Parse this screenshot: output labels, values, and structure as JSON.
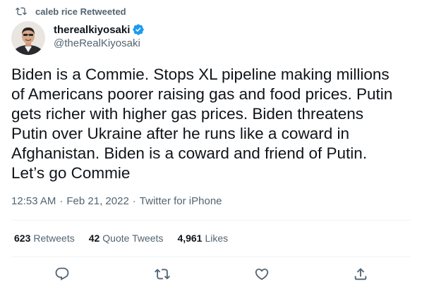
{
  "retweet_context": {
    "label": "caleb rice Retweeted",
    "icon": "retweet-icon"
  },
  "author": {
    "display_name": "therealkiyosaki",
    "handle": "@theRealKiyosaki",
    "verified": true,
    "verified_icon": "verified-badge-icon"
  },
  "tweet": {
    "text": "Biden is a Commie. Stops XL pipeline making millions\nof Americans poorer raising gas and food prices. Putin\ngets richer with higher gas prices.  Biden threatens\nPutin over Ukraine after he runs like a coward in\nAfghanistan. Biden is a coward and friend of Putin.\nLet’s go Commie",
    "time": "12:53 AM",
    "date": "Feb 21, 2022",
    "source": "Twitter for iPhone",
    "separator": "·"
  },
  "stats": [
    {
      "count": "623",
      "label": "Retweets"
    },
    {
      "count": "42",
      "label": "Quote Tweets"
    },
    {
      "count": "4,961",
      "label": "Likes"
    }
  ],
  "actions": [
    "reply-icon",
    "retweet-icon",
    "like-icon",
    "share-icon"
  ],
  "colors": {
    "text": "#0f1419",
    "secondary": "#536471",
    "verified": "#1d9bf0",
    "divider": "#eff3f4"
  }
}
